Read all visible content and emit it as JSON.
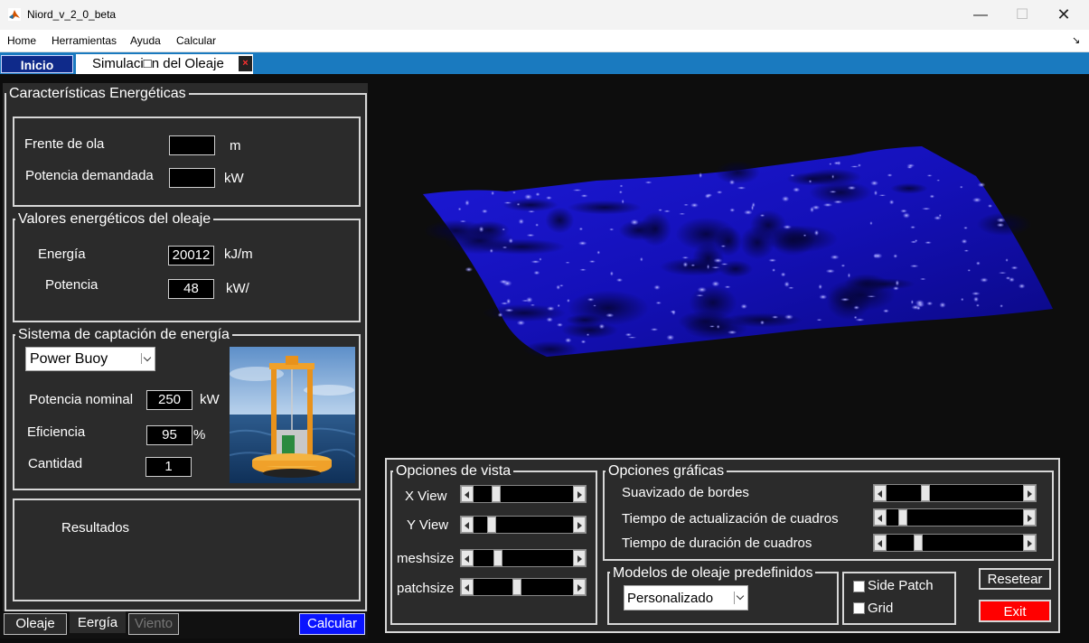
{
  "window": {
    "title": "Niord_v_2_0_beta",
    "minimize_glyph": "—",
    "maximize_glyph": "☐",
    "close_glyph": "✕"
  },
  "menu": {
    "items": [
      "Home",
      "Herramientas",
      "Ayuda",
      "Calcular"
    ],
    "overflow_glyph": "↘"
  },
  "tabs": {
    "inicio": "Inicio",
    "simulacion": "Simulaci□n del Oleaje",
    "close_glyph": "×"
  },
  "caracteristicas": {
    "title": "Características Energéticas",
    "frente_label": "Frente de ola",
    "frente_value": "",
    "frente_unit": "m",
    "potencia_label": "Potencia demandada",
    "potencia_value": "",
    "potencia_unit": "kW"
  },
  "valores": {
    "title": "Valores energéticos del oleaje",
    "energia_label": "Energía",
    "energia_value": "20012",
    "energia_unit": "kJ/m",
    "potencia_label": "Potencia",
    "potencia_value": "48",
    "potencia_unit": "kW/"
  },
  "sistema": {
    "title": "Sistema de captación de energía",
    "selected": "Power Buoy",
    "nominal_label": "Potencia nominal",
    "nominal_value": "250",
    "nominal_unit": "kW",
    "eficiencia_label": "Eficiencia",
    "eficiencia_value": "95",
    "eficiencia_unit": "%",
    "cantidad_label": "Cantidad",
    "cantidad_value": "1"
  },
  "resultados": {
    "label": "Resultados"
  },
  "bottom_tabs": {
    "oleaje": "Oleaje",
    "energia": "Eergía",
    "viento": "Viento",
    "calcular": "Calcular"
  },
  "vista": {
    "title": "Opciones de vista",
    "sliders": [
      {
        "label": "X View",
        "value": 0.2
      },
      {
        "label": "Y View",
        "value": 0.15
      },
      {
        "label": "meshsize",
        "value": 0.22
      },
      {
        "label": "patchsize",
        "value": 0.43
      }
    ]
  },
  "graficas": {
    "title": "Opciones gráficas",
    "sliders": [
      {
        "label": "Suavizado de bordes",
        "value": 0.27
      },
      {
        "label": "Tiempo de actualización de cuadros",
        "value": 0.09
      },
      {
        "label": "Tiempo de duración de cuadros",
        "value": 0.21
      }
    ]
  },
  "modelos": {
    "title": "Modelos de oleaje predefinidos",
    "selected": "Personalizado"
  },
  "checks": {
    "side_patch": "Side Patch",
    "grid": "Grid"
  },
  "buttons": {
    "resetear": "Resetear",
    "exit": "Exit"
  },
  "colors": {
    "wave": "#1a17d8",
    "background": "#0d0d0d",
    "panel": "#2b2b2b",
    "tab_blue": "#1a7abf",
    "calcular": "#0a14ff",
    "exit": "#ff0000"
  }
}
